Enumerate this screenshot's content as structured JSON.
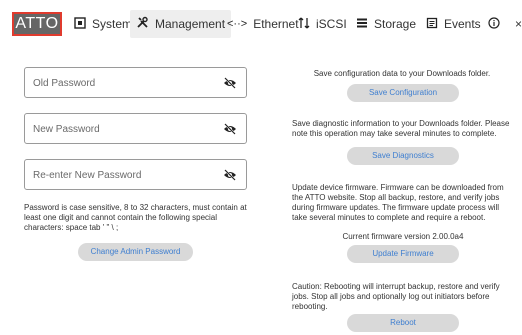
{
  "header": {
    "logo": "ATTO",
    "tabs": [
      {
        "label": "System",
        "icon": "system-icon"
      },
      {
        "label": "Management",
        "icon": "wrench-tools-icon"
      },
      {
        "label": "Ethernet",
        "icon": "ethernet-icon"
      },
      {
        "label": "iSCSI",
        "icon": "iscsi-icon"
      },
      {
        "label": "Storage",
        "icon": "storage-icon"
      },
      {
        "label": "Events",
        "icon": "events-icon"
      }
    ],
    "active_tab": "Management"
  },
  "password_form": {
    "old_placeholder": "Old Password",
    "new_placeholder": "New Password",
    "reenter_placeholder": "Re-enter New Password",
    "help_text": "Password is case sensitive, 8 to 32 characters, must contain at least one digit and cannot contain the following special characters: space tab ' \" \\ ;",
    "change_button": "Change Admin Password"
  },
  "right_panel": {
    "save_config_text": "Save configuration data to your Downloads folder.",
    "save_config_button": "Save Configuration",
    "save_diag_text": "Save diagnostic information to your Downloads folder. Please note this operation may take several minutes to complete.",
    "save_diag_button": "Save Diagnostics",
    "firmware_text": "Update device firmware. Firmware can be downloaded from the ATTO website. Stop all backup, restore, and verify jobs during firmware updates. The firmware update process will take several minutes to complete and require a reboot.",
    "firmware_version": "Current firmware version 2.00.0a4",
    "update_button": "Update Firmware",
    "reboot_text": "Caution: Rebooting will interrupt backup, restore and verify jobs. Stop all jobs and optionally log out initiators before rebooting.",
    "reboot_button": "Reboot"
  },
  "colors": {
    "logo_border": "#e03b2e",
    "button_text": "#3f7fd0",
    "button_bg": "#d9d9d9"
  }
}
